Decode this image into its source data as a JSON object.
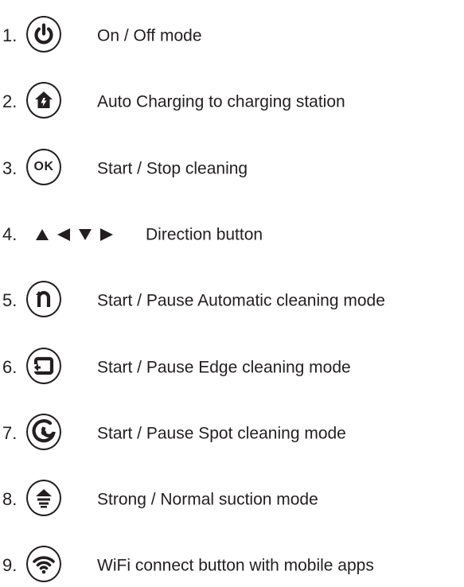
{
  "items": [
    {
      "number": "1.",
      "icon": "power-icon",
      "label": "On / Off mode"
    },
    {
      "number": "2.",
      "icon": "home-charging-icon",
      "label": "Auto Charging to charging station"
    },
    {
      "number": "3.",
      "icon": "ok-icon",
      "icon_text": "OK",
      "label": "Start / Stop cleaning"
    },
    {
      "number": "4.",
      "icon": "direction-arrows-icon",
      "label": "Direction button"
    },
    {
      "number": "5.",
      "icon": "auto-cleaning-icon",
      "label": "Start / Pause Automatic cleaning mode"
    },
    {
      "number": "6.",
      "icon": "edge-cleaning-icon",
      "label": "Start / Pause Edge cleaning mode"
    },
    {
      "number": "7.",
      "icon": "spot-cleaning-icon",
      "label": "Start / Pause Spot cleaning mode"
    },
    {
      "number": "8.",
      "icon": "suction-mode-icon",
      "label": "Strong / Normal suction mode"
    },
    {
      "number": "9.",
      "icon": "wifi-icon",
      "label": "WiFi connect button with mobile apps"
    }
  ],
  "colors": {
    "text": "#231f20",
    "background": "#ffffff"
  }
}
